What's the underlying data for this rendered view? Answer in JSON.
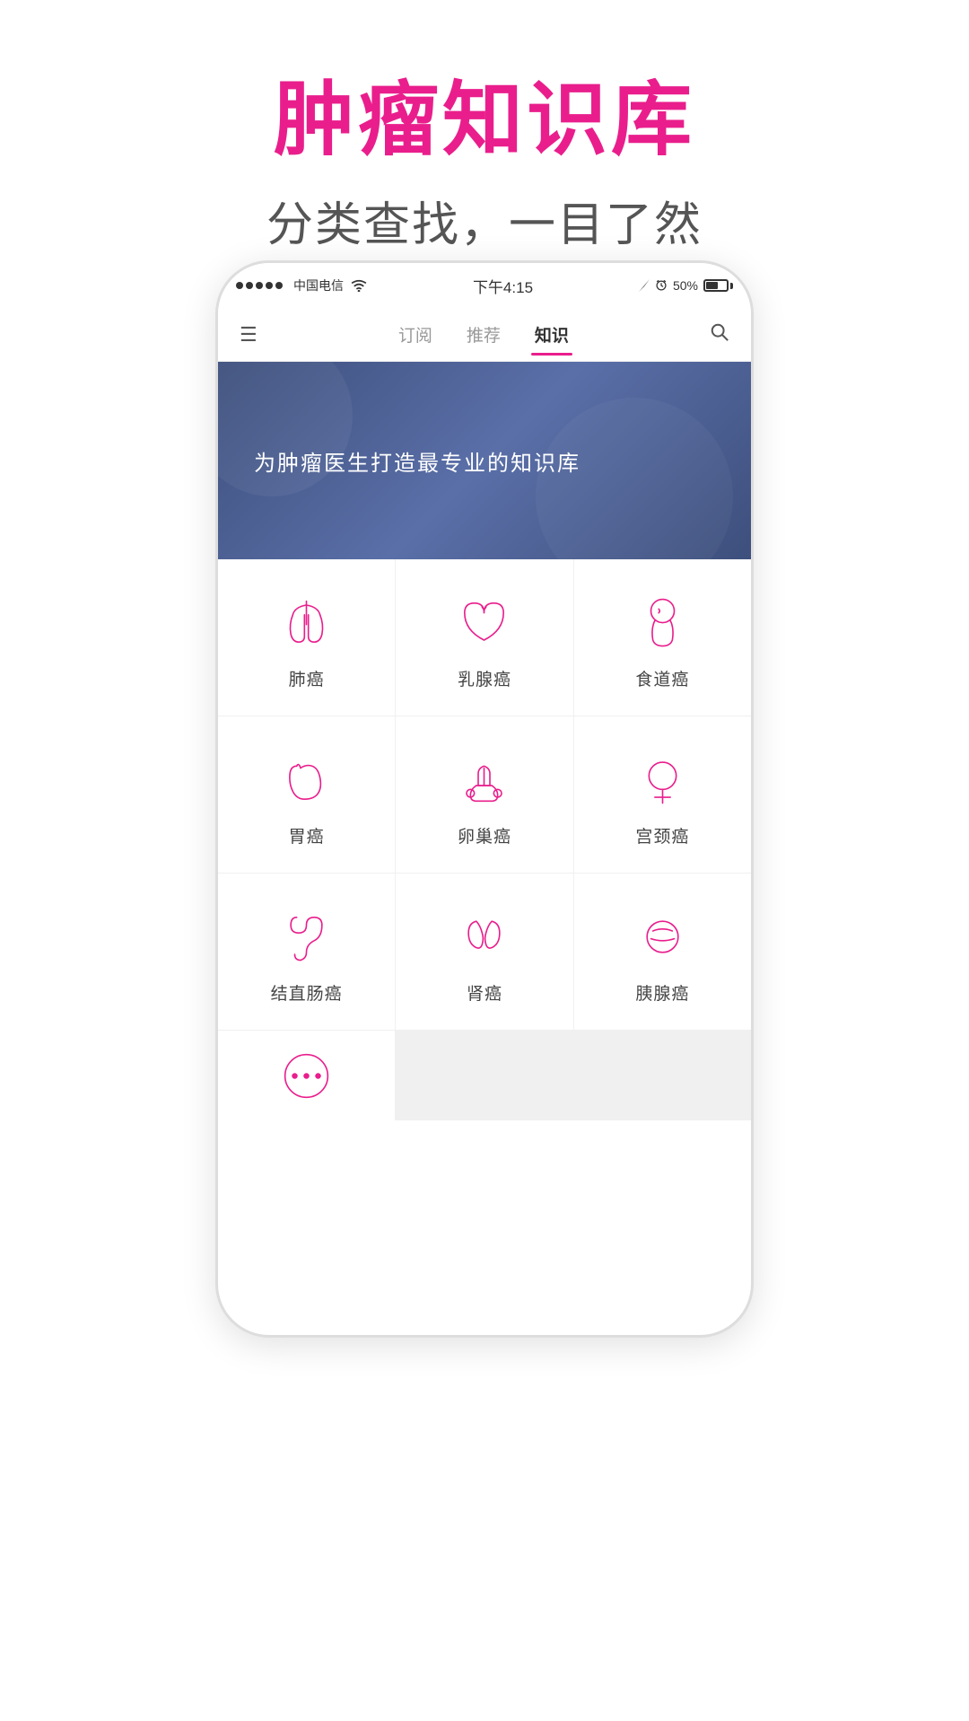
{
  "header": {
    "title": "肿瘤知识库",
    "subtitle": "分类查找，一目了然"
  },
  "statusBar": {
    "carrier": "中国电信",
    "wifi": "WiFi",
    "time": "下午4:15",
    "battery": "50%"
  },
  "navTabs": [
    {
      "label": "订阅",
      "active": false
    },
    {
      "label": "推荐",
      "active": false
    },
    {
      "label": "知识",
      "active": true
    }
  ],
  "banner": {
    "text": "为肿瘤医生打造最专业的知识库"
  },
  "cancerTypes": [
    {
      "id": "lung",
      "label": "肺癌",
      "iconType": "lung"
    },
    {
      "id": "breast",
      "label": "乳腺癌",
      "iconType": "breast"
    },
    {
      "id": "esophagus",
      "label": "食道癌",
      "iconType": "esophagus"
    },
    {
      "id": "stomach",
      "label": "胃癌",
      "iconType": "stomach"
    },
    {
      "id": "ovary",
      "label": "卵巢癌",
      "iconType": "ovary"
    },
    {
      "id": "cervix",
      "label": "宫颈癌",
      "iconType": "cervix"
    },
    {
      "id": "colorectal",
      "label": "结直肠癌",
      "iconType": "colorectal"
    },
    {
      "id": "kidney",
      "label": "肾癌",
      "iconType": "kidney"
    },
    {
      "id": "pancreas",
      "label": "胰腺癌",
      "iconType": "pancreas"
    },
    {
      "id": "more",
      "label": "",
      "iconType": "more"
    }
  ],
  "colors": {
    "brand": "#e91e8c",
    "navActive": "#e91e8c",
    "bannerBg": "#3d4f7c",
    "gridBorder": "#f0f0f0"
  }
}
